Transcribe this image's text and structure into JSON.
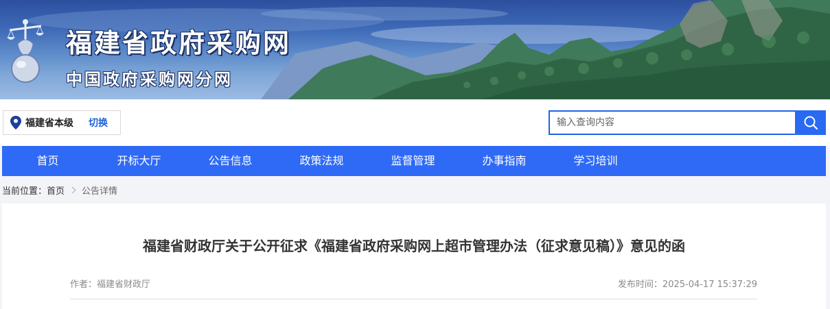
{
  "header": {
    "title": "福建省政府采购网",
    "subtitle": "中国政府采购网分网"
  },
  "region": {
    "name": "福建省本级",
    "switch_label": "切换"
  },
  "search": {
    "placeholder": "输入查询内容"
  },
  "nav": {
    "items": [
      "首页",
      "开标大厅",
      "公告信息",
      "政策法规",
      "监督管理",
      "办事指南",
      "学习培训"
    ]
  },
  "breadcrumb": {
    "prefix": "当前位置：",
    "home": "首页",
    "current": "公告详情"
  },
  "article": {
    "title": "福建省财政厅关于公开征求《福建省政府采购网上超市管理办法（征求意见稿）》意见的函",
    "author": "作者：福建省财政厅",
    "published": "发布时间：2025-04-17 15:37:29"
  },
  "colors": {
    "primary": "#2f6af6",
    "link": "#1e62d8"
  },
  "icons": {
    "location": "map-pin-icon",
    "search": "search-icon",
    "logo": "scales-emblem"
  }
}
